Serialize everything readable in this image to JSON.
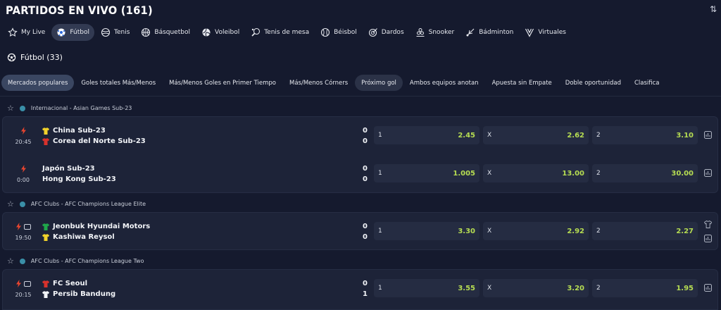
{
  "header": {
    "title": "PARTIDOS EN VIVO",
    "count": "(161)",
    "sort_icon": "sort-arrows-icon"
  },
  "sports": [
    {
      "label": "My Live",
      "icon": "star-icon",
      "active": false
    },
    {
      "label": "Fútbol",
      "icon": "soccer-ball-icon",
      "active": true
    },
    {
      "label": "Tenis",
      "icon": "tennis-ball-icon",
      "active": false
    },
    {
      "label": "Básquetbol",
      "icon": "basketball-icon",
      "active": false
    },
    {
      "label": "Voleibol",
      "icon": "volleyball-icon",
      "active": false
    },
    {
      "label": "Tenis de mesa",
      "icon": "ping-pong-icon",
      "active": false
    },
    {
      "label": "Béisbol",
      "icon": "baseball-icon",
      "active": false
    },
    {
      "label": "Dardos",
      "icon": "darts-icon",
      "active": false
    },
    {
      "label": "Snooker",
      "icon": "snooker-icon",
      "active": false
    },
    {
      "label": "Bádminton",
      "icon": "shuttlecock-icon",
      "active": false
    },
    {
      "label": "Virtuales",
      "icon": "virtual-icon",
      "active": false
    }
  ],
  "section": {
    "title": "Fútbol (33)"
  },
  "markets": [
    "Mercados populares",
    "Goles totales Más/Menos",
    "Más/Menos Goles en Primer Tiempo",
    "Más/Menos Córners",
    "Próximo gol",
    "Ambos equipos anotan",
    "Apuesta sin Empate",
    "Doble oportunidad",
    "Clasifica"
  ],
  "leagues": [
    {
      "name": "Internacional - Asian Games Sub-23",
      "matches": [
        {
          "time": "20:45",
          "home": "China Sub-23",
          "away": "Corea del Norte Sub-23",
          "home_score": "0",
          "away_score": "0",
          "o1": "2.45",
          "ox": "2.62",
          "o2": "3.10"
        },
        {
          "time": "0:00",
          "home": "Japón Sub-23",
          "away": "Hong Kong Sub-23",
          "home_score": "0",
          "away_score": "0",
          "o1": "1.005",
          "ox": "13.00",
          "o2": "30.00"
        }
      ]
    },
    {
      "name": "AFC Clubs - AFC Champions League Elite",
      "matches": [
        {
          "time": "19:50",
          "home": "Jeonbuk Hyundai Motors",
          "away": "Kashiwa Reysol",
          "home_score": "0",
          "away_score": "0",
          "o1": "3.30",
          "ox": "2.92",
          "o2": "2.27"
        }
      ]
    },
    {
      "name": "AFC Clubs - AFC Champions League Two",
      "matches": [
        {
          "time": "20:15",
          "home": "FC Seoul",
          "away": "Persib Bandung",
          "home_score": "0",
          "away_score": "1",
          "o1": "3.55",
          "ox": "3.20",
          "o2": "1.95"
        }
      ]
    }
  ],
  "odd_labels": {
    "one": "1",
    "draw": "X",
    "two": "2"
  },
  "colors": {
    "background": "#151a2e",
    "card": "#1d2338",
    "odd_value": "#b6dd52",
    "live_bolt": "#e8452f"
  }
}
